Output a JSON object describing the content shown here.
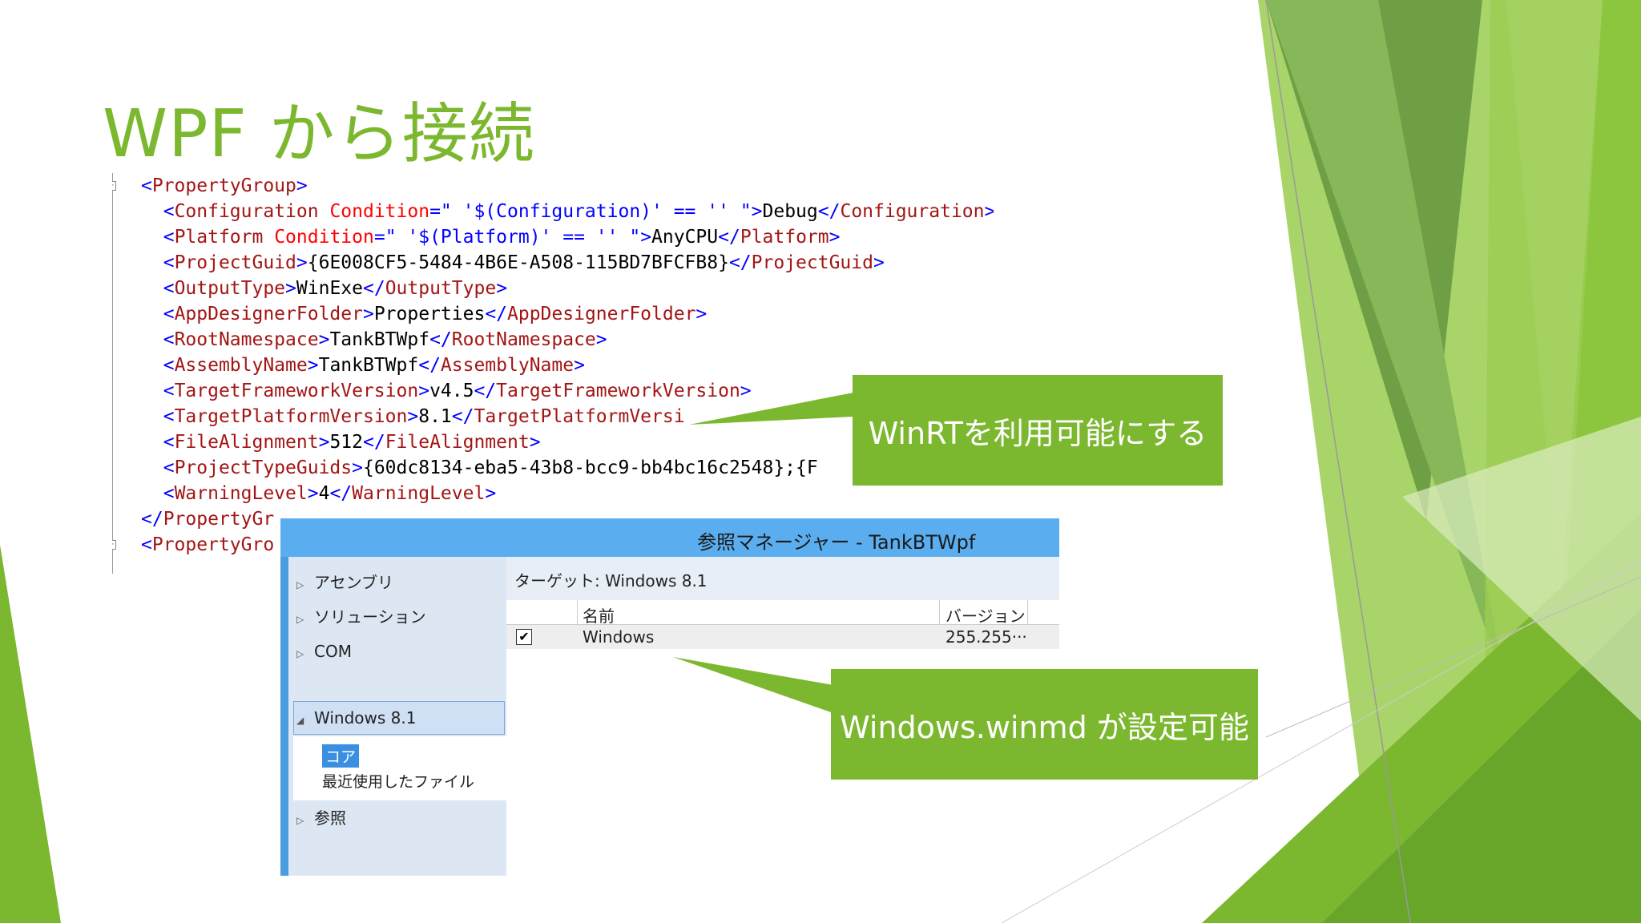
{
  "slide": {
    "title": "WPF から接続"
  },
  "code": {
    "lines": [
      "<PropertyGroup>",
      "  <Configuration Condition=\" '$(Configuration)' == '' \">Debug</Configuration>",
      "  <Platform Condition=\" '$(Platform)' == '' \">AnyCPU</Platform>",
      "  <ProjectGuid>{6E008CF5-5484-4B6E-A508-115BD7BFCFB8}</ProjectGuid>",
      "  <OutputType>WinExe</OutputType>",
      "  <AppDesignerFolder>Properties</AppDesignerFolder>",
      "  <RootNamespace>TankBTWpf</RootNamespace>",
      "  <AssemblyName>TankBTWpf</AssemblyName>",
      "  <TargetFrameworkVersion>v4.5</TargetFrameworkVersion>",
      "  <TargetPlatformVersion>8.1</TargetPlatformVersi",
      "  <FileAlignment>512</FileAlignment>",
      "  <ProjectTypeGuids>{60dc8134-eba5-43b8-bcc9-bb4bc16c2548};{F",
      "  <WarningLevel>4</WarningLevel>",
      "</PropertyGr",
      "<PropertyGro"
    ]
  },
  "callouts": {
    "winrt": "WinRTを利用可能にする",
    "winmd": "Windows.winmd が設定可能"
  },
  "dialog": {
    "title": "参照マネージャー - TankBTWpf",
    "sidebar": {
      "assemblies": "アセンブリ",
      "solution": "ソリューション",
      "com": "COM",
      "windows": "Windows 8.1",
      "core": "コア",
      "recent": "最近使用したファイル",
      "browse": "参照"
    },
    "target": "ターゲット: Windows 8.1",
    "columns": {
      "name": "名前",
      "version": "バージョン"
    },
    "row": {
      "checked": true,
      "name": "Windows",
      "version": "255.255···"
    }
  },
  "colors": {
    "accent": "#7cb82f",
    "dialog_title": "#5aaeef"
  }
}
